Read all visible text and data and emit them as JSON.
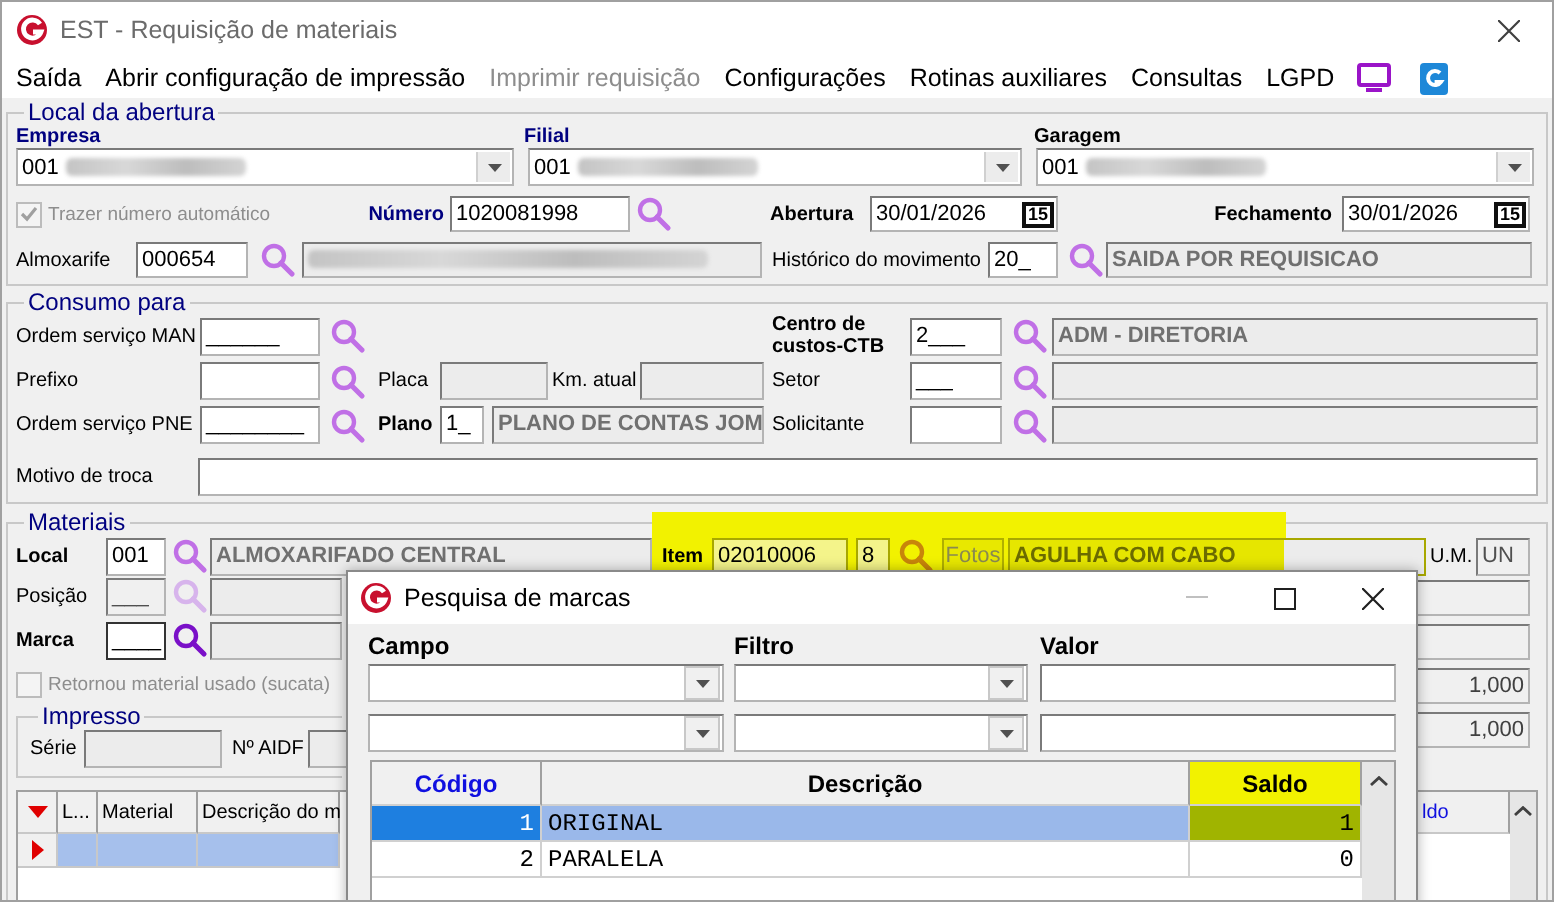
{
  "window": {
    "title": "EST - Requisição de materiais"
  },
  "menu": [
    {
      "label": "Saída",
      "disabled": false
    },
    {
      "label": "Abrir configuração de impressão",
      "disabled": false
    },
    {
      "label": "Imprimir requisição",
      "disabled": true
    },
    {
      "label": "Configurações",
      "disabled": false
    },
    {
      "label": "Rotinas auxiliares",
      "disabled": false
    },
    {
      "label": "Consultas",
      "disabled": false
    },
    {
      "label": "LGPD",
      "disabled": false
    }
  ],
  "local_abertura": {
    "legend": "Local da abertura",
    "empresa": {
      "label": "Empresa",
      "value": "001",
      "redacted": true
    },
    "filial": {
      "label": "Filial",
      "value": "001",
      "redacted": true
    },
    "garagem": {
      "label": "Garagem",
      "value": "001",
      "redacted": true
    },
    "trazer_numero": {
      "label": "Trazer número automático",
      "checked": true,
      "disabled": true
    },
    "numero": {
      "label": "Número",
      "value": "1020081998"
    },
    "abertura": {
      "label": "Abertura",
      "value": "30/01/2026",
      "calendar": "15"
    },
    "fechamento": {
      "label": "Fechamento",
      "value": "30/01/2026",
      "calendar": "15"
    },
    "almoxarife": {
      "label": "Almoxarife",
      "value": "000654",
      "redacted": true
    },
    "historico": {
      "label": "Histórico do movimento",
      "value": "20_",
      "description": "SAIDA POR REQUISICAO"
    }
  },
  "consumo": {
    "legend": "Consumo para",
    "os_man": {
      "label": "Ordem serviço MAN",
      "value": "______"
    },
    "centro_custos": {
      "label": "Centro de custos-CTB",
      "value": "2___",
      "description": "ADM - DIRETORIA"
    },
    "prefixo": {
      "label": "Prefixo"
    },
    "placa": {
      "label": "Placa"
    },
    "km_atual": {
      "label": "Km. atual"
    },
    "setor": {
      "label": "Setor",
      "value": "___"
    },
    "os_pne": {
      "label": "Ordem serviço PNE",
      "value": "________"
    },
    "plano": {
      "label": "Plano",
      "value": "1_",
      "description": "PLANO DE CONTAS JOM"
    },
    "solicitante": {
      "label": "Solicitante"
    },
    "motivo": {
      "label": "Motivo de troca"
    }
  },
  "materiais": {
    "legend": "Materiais",
    "local": {
      "label": "Local",
      "value": "001",
      "description": "ALMOXARIFADO CENTRAL"
    },
    "item": {
      "label": "Item",
      "value": "02010006",
      "digit": "8",
      "photos_button": "Fotos",
      "description": "AGULHA COM CABO",
      "highlighted": true
    },
    "um": {
      "label": "U.M.",
      "value": "UN"
    },
    "posicao": {
      "label": "Posição",
      "value": "___",
      "disabled": true
    },
    "marca": {
      "label": "Marca",
      "value": "____",
      "focused": true
    },
    "retornou": {
      "label": "Retornou material usado (sucata)",
      "checked": false,
      "disabled": true
    },
    "side_fields": [
      {
        "disabled": true
      },
      {
        "disabled": true
      },
      {
        "value": "1,000",
        "disabled": true
      },
      {
        "value": "1,000",
        "disabled": true
      }
    ],
    "impresso": {
      "legend": "Impresso",
      "serie": {
        "label": "Série"
      },
      "aidf": {
        "label": "Nº AIDF"
      }
    },
    "grid": {
      "columns": [
        "L...",
        "Material",
        "Descrição do m"
      ],
      "right_column": "ldo",
      "rows": [
        {
          "selected": true
        }
      ]
    }
  },
  "dialog": {
    "title": "Pesquisa de marcas",
    "filter_labels": [
      "Campo",
      "Filtro",
      "Valor"
    ],
    "columns": [
      {
        "label": "Código",
        "highlighted": false
      },
      {
        "label": "Descrição",
        "highlighted": false
      },
      {
        "label": "Saldo",
        "highlighted": true
      }
    ],
    "rows": [
      {
        "code": "1",
        "description": "ORIGINAL",
        "saldo": "1",
        "selected": true
      },
      {
        "code": "2",
        "description": "PARALELA",
        "saldo": "0",
        "selected": false
      }
    ]
  }
}
